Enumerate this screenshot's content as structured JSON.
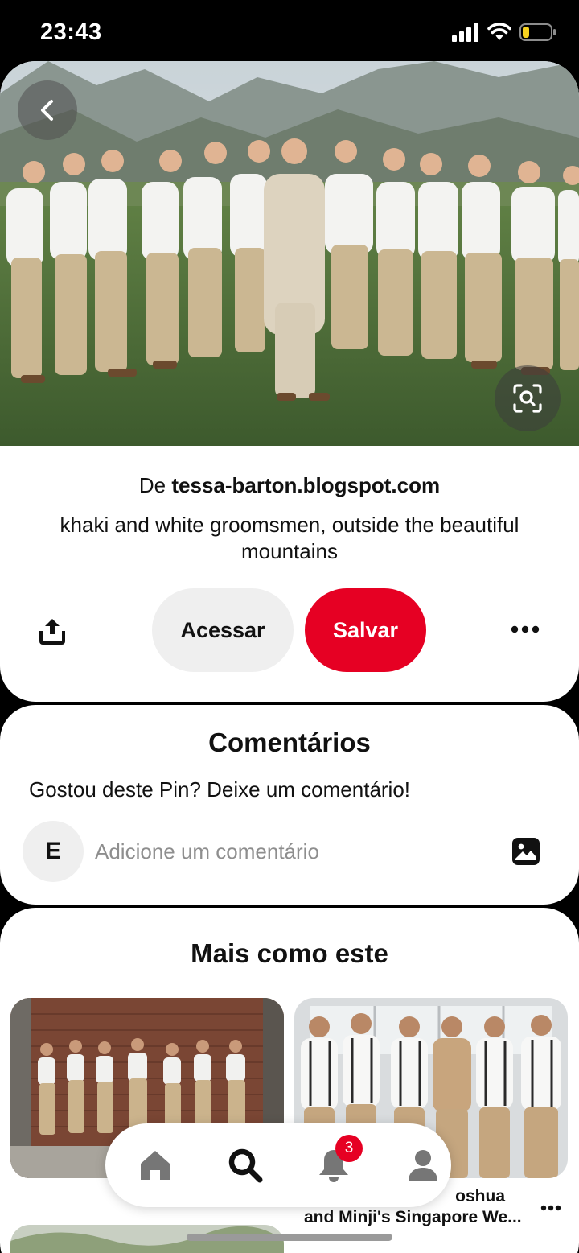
{
  "status_bar": {
    "time": "23:43",
    "icons": [
      "cellular-signal-icon",
      "wifi-icon",
      "battery-low-icon"
    ]
  },
  "pin": {
    "image_description": "groomsmen-photo",
    "source_prefix": "De ",
    "source_domain": "tessa-barton.blogspot.com",
    "description": "khaki and white groomsmen, outside the beautiful mountains",
    "visit_label": "Acessar",
    "save_label": "Salvar",
    "icons": [
      "back-chevron-icon",
      "visual-search-icon",
      "share-icon",
      "more-options-icon"
    ]
  },
  "comments": {
    "title": "Comentários",
    "prompt": "Gostou deste Pin? Deixe um comentário!",
    "avatar_initial": "E",
    "input_placeholder": "Adicione um comentário"
  },
  "more_like_this": {
    "title": "Mais como este",
    "caption_line1": "oshua",
    "caption_line2": "and Minji's Singapore We..."
  },
  "bottom_nav": {
    "items": [
      "home-icon",
      "search-icon",
      "notifications-icon",
      "profile-icon"
    ],
    "notification_count": "3"
  },
  "colors": {
    "accent": "#e60023",
    "button_gray": "#efefef",
    "text": "#111111",
    "placeholder": "#8e8e8e"
  }
}
